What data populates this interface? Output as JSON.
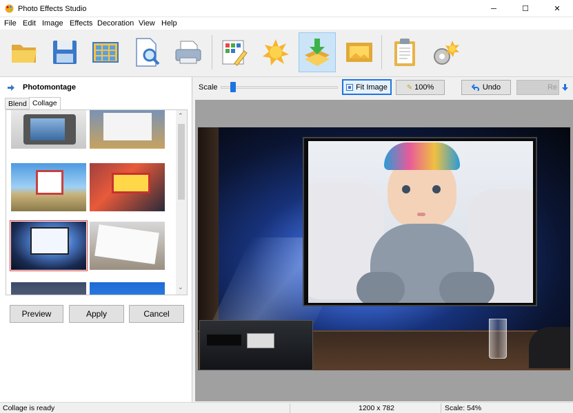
{
  "window": {
    "title": "Photo Effects Studio",
    "minimize": "─",
    "maximize": "☐",
    "close": "✕"
  },
  "menu": [
    "File",
    "Edit",
    "Image",
    "Effects",
    "Decoration",
    "View",
    "Help"
  ],
  "toolbar": {
    "icons": [
      "open-folder-icon",
      "save-icon",
      "grid-icon",
      "zoom-document-icon",
      "printer-icon",
      "edit-grid-icon",
      "sun-effect-icon",
      "photomontage-icon",
      "frame-icon",
      "clipboard-icon",
      "settings-sun-icon"
    ]
  },
  "panel": {
    "title": "Photomontage",
    "tabs": [
      "Blend",
      "Collage"
    ],
    "buttons": {
      "preview": "Preview",
      "apply": "Apply",
      "cancel": "Cancel"
    }
  },
  "scale": {
    "label": "Scale",
    "fit_image": "Fit Image",
    "zoom_100": "100%",
    "undo": "Undo",
    "redo": "Re",
    "slider_value": 0.05
  },
  "status": {
    "text": "Collage is ready",
    "dimensions": "1200 x 782",
    "scale": "Scale: 54%"
  }
}
